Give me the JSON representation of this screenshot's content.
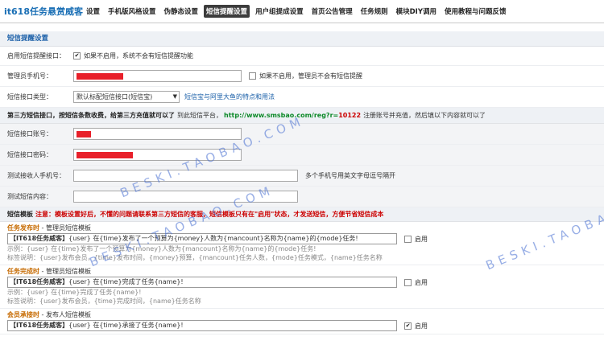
{
  "brand": "it618任务悬赏威客",
  "nav": [
    "设置",
    "手机版风格设置",
    "伪静态设置",
    "短信提醒设置",
    "用户组提成设置",
    "首页公告管理",
    "任务规则",
    "模块DIY调用",
    "使用教程与问题反馈"
  ],
  "nav_active": "短信提醒设置",
  "section_title": "短信提醒设置",
  "enable_sms": {
    "label": "启用短信提醒接口：",
    "checked": true,
    "text": "如果不启用，系统不会有短信提醒功能"
  },
  "admin_phone": {
    "label": "管理员手机号：",
    "note": "如果不启用，管理员不会有短信提醒"
  },
  "interface_type": {
    "label": "短信接口类型：",
    "selected": "默认标配短信接口(短信宝)",
    "link": "短信宝与阿里大鱼的特点和用法"
  },
  "notice": {
    "lead": "第三方短信接口，按短信条数收费，给第三方充值就可以了",
    "mid": "到此短信平台，",
    "url_host": "http://www.smsbao.com/reg?r=",
    "url_code": "10122",
    "tail": "注册账号并充值，然后填以下内容就可以了"
  },
  "account": {
    "label": "短信接口账号："
  },
  "password": {
    "label": "短信接口密码："
  },
  "test_phone": {
    "label": "测试接收人手机号：",
    "note": "多个手机号用英文字母逗号隔开"
  },
  "test_content": {
    "label": "测试短信内容："
  },
  "templates_header": {
    "title": "短信模板",
    "warn": "注意：模板设置好后，不懂的问题请联系第三方短信的客服，短信模板只有在\"启用\"状态，才发送短信，方便节省短信成本"
  },
  "enable_label": "启用",
  "templates": [
    {
      "key": "任务发布时",
      "desc": " - 管理员短信模板",
      "prefix": "【IT618任务威客】",
      "body": "{user} 在{time}发布了一个预算为{money}人数为{mancount}名称为{name}的{mode}任务!",
      "example": "示例：{user} 在{time}发布了一个预算为{money}人数为{mancount}名称为{name}的{mode}任务!",
      "hint": "标签说明：{user}发布会员，{time}发布时间，{money}预算，{mancount}任务人数，{mode}任务模式，{name}任务名称",
      "enabled": false
    },
    {
      "key": "任务完成时",
      "desc": " - 管理员短信模板",
      "prefix": "【IT618任务威客】",
      "body": "{user} 在{time}完成了任务{name}!",
      "example": "示例：{user} 在{time}完成了任务{name}!",
      "hint": "标签说明：{user}发布会员，{time}完成时间，{name}任务名称",
      "enabled": false
    },
    {
      "key": "会员承接时",
      "desc": " - 发布人短信模板",
      "prefix": "【IT618任务威客】",
      "body": "{user} 在{time}承接了任务{name}!",
      "example": "",
      "hint": "",
      "enabled": true
    }
  ],
  "watermarks": [
    "BESKI.TAOBAO.COM",
    "BESKI.TAOBAO.COM",
    "BESKI.TAOBAO.COM"
  ],
  "colors": {
    "accent": "#1a5fa8",
    "redacted": "#e8202a",
    "warning": "#cc0000",
    "link_green": "#0e8a2a"
  }
}
